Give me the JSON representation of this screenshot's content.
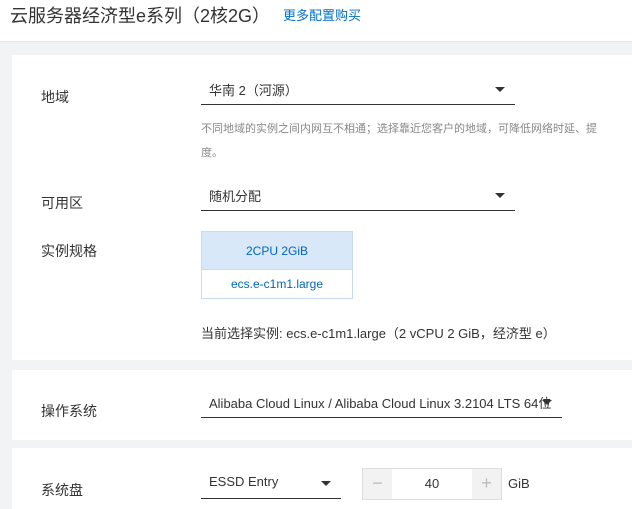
{
  "header": {
    "title": "云服务器经济型e系列（2核2G）",
    "more_link": "更多配置购买"
  },
  "region": {
    "label": "地域",
    "value": "华南 2（河源）",
    "hint_line1": "不同地域的实例之间内网互不相通；选择靠近您客户的地域，可降低网络时延、提",
    "hint_line2": "度。"
  },
  "zone": {
    "label": "可用区",
    "value": "随机分配"
  },
  "spec": {
    "label": "实例规格",
    "card_title": "2CPU 2GiB",
    "card_type": "ecs.e-c1m1.large",
    "current": "当前选择实例: ecs.e-c1m1.large（2 vCPU 2 GiB，经济型 e）"
  },
  "os": {
    "label": "操作系统",
    "value": "Alibaba Cloud Linux / Alibaba Cloud Linux 3.2104 LTS 64位"
  },
  "disk": {
    "label": "系统盘",
    "type": "ESSD Entry",
    "minus": "−",
    "size": "40",
    "plus": "+",
    "unit": "GiB"
  }
}
